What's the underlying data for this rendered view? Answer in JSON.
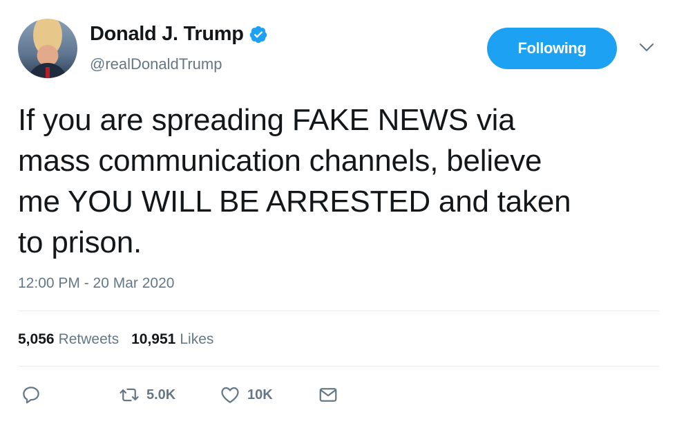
{
  "author": {
    "name": "Donald J. Trump",
    "handle": "@realDonaldTrump",
    "verified": true
  },
  "follow_button": {
    "label": "Following"
  },
  "tweet": {
    "lines": [
      "If you are spreading FAKE NEWS via",
      "mass communication channels, believe",
      "me YOU WILL BE ARRESTED and taken",
      "to prison."
    ],
    "timestamp": "12:00 PM - 20 Mar 2020"
  },
  "stats": {
    "retweets_count": "5,056",
    "retweets_label": "Retweets",
    "likes_count": "10,951",
    "likes_label": "Likes"
  },
  "actions": {
    "reply_icon": "reply-icon",
    "retweet_count": "5.0K",
    "like_count": "10K",
    "message_icon": "message-icon"
  },
  "colors": {
    "accent": "#1da1f2",
    "text": "#14171a",
    "muted": "#657786",
    "divider": "#e6ecf0"
  }
}
